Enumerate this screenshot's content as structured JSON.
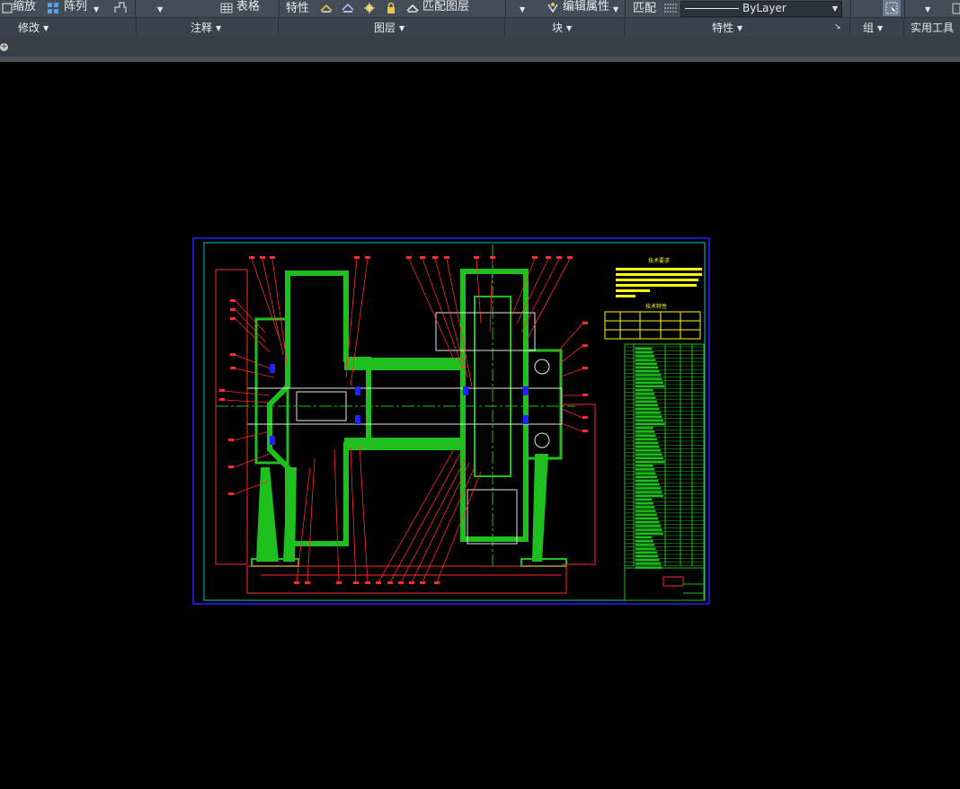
{
  "ribbon": {
    "row1": {
      "zoom": "缩放",
      "array": "阵列",
      "table": "表格",
      "properties": "特性",
      "match_layer": "匹配图层",
      "edit_attr": "编辑属性",
      "match": "匹配",
      "linetype": "ByLayer"
    },
    "panels": {
      "modify": "修改",
      "annotate": "注释",
      "layers": "图层",
      "block": "块",
      "properties": "特性",
      "group": "组",
      "utilities": "实用工具"
    }
  },
  "tabs": {
    "add": "+"
  },
  "drawing": {
    "tech_requirements_title": "技术要求",
    "tech_specs_title": "技术特性",
    "colors": {
      "frame": "#2222ff",
      "border": "#00c8c8",
      "part": "#1fbf1f",
      "leader": "#ff2a2a",
      "text": "#ffff00"
    }
  }
}
